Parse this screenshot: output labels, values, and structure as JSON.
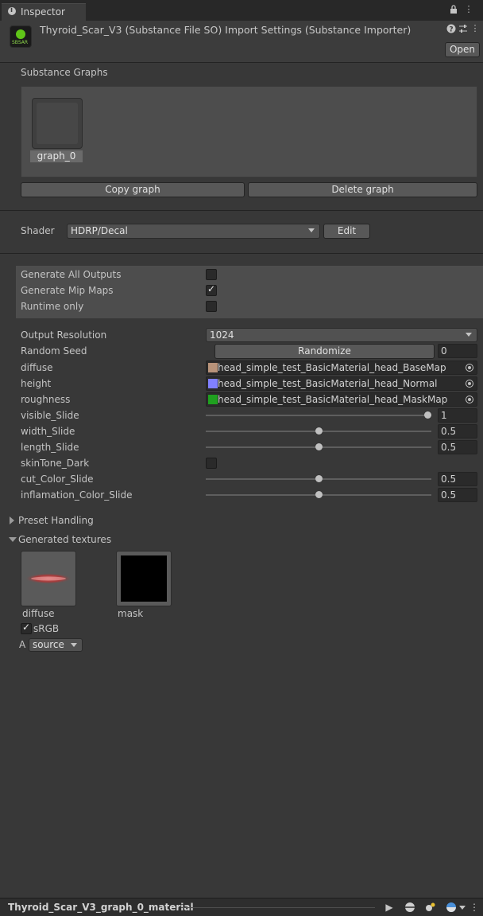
{
  "tab": {
    "title": "Inspector",
    "icon": "info-icon"
  },
  "header": {
    "title": "Thyroid_Scar_V3 (Substance File SO) Import Settings (Substance Importer)",
    "icon": "substance-icon",
    "icon_label": "SBSAR",
    "open_label": "Open"
  },
  "graphs": {
    "heading": "Substance Graphs",
    "items": [
      {
        "name": "graph_0"
      }
    ],
    "copy_label": "Copy graph",
    "delete_label": "Delete graph"
  },
  "shader": {
    "label": "Shader",
    "value": "HDRP/Decal",
    "edit_label": "Edit"
  },
  "generation": {
    "options": [
      {
        "label": "Generate All Outputs",
        "checked": false
      },
      {
        "label": "Generate Mip Maps",
        "checked": true
      },
      {
        "label": "Runtime only",
        "checked": false
      }
    ]
  },
  "params": {
    "output_resolution": {
      "label": "Output Resolution",
      "value": "1024"
    },
    "random_seed": {
      "label": "Random Seed",
      "button": "Randomize",
      "value": "0"
    },
    "textures": [
      {
        "label": "diffuse",
        "value": "head_simple_test_BasicMaterial_head_BaseMap",
        "color": "#b8937a"
      },
      {
        "label": "height",
        "value": "head_simple_test_BasicMaterial_head_Normal",
        "color": "#8080ff"
      },
      {
        "label": "roughness",
        "value": "head_simple_test_BasicMaterial_head_MaskMap",
        "color": "#1fa01f"
      }
    ],
    "sliders": {
      "visible": {
        "label": "visible_Slide",
        "value": "1",
        "level": 1.0
      },
      "width": {
        "label": "width_Slide",
        "value": "0.5",
        "level": 0.5
      },
      "length": {
        "label": "length_Slide",
        "value": "0.5",
        "level": 0.5
      },
      "skin": {
        "label": "skinTone_Dark",
        "checked": false
      },
      "cut": {
        "label": "cut_Color_Slide",
        "value": "0.5",
        "level": 0.5
      },
      "inflam": {
        "label": "inflamation_Color_Slide",
        "value": "0.5",
        "level": 0.5
      }
    }
  },
  "preset": {
    "label": "Preset Handling"
  },
  "generated": {
    "label": "Generated textures",
    "items": [
      {
        "name": "diffuse"
      },
      {
        "name": "mask"
      }
    ],
    "srgb_label": "sRGB",
    "srgb_checked": true,
    "alpha_prefix": "A",
    "alpha_source": "source"
  },
  "status": {
    "title": "Thyroid_Scar_V3_graph_0_material"
  }
}
